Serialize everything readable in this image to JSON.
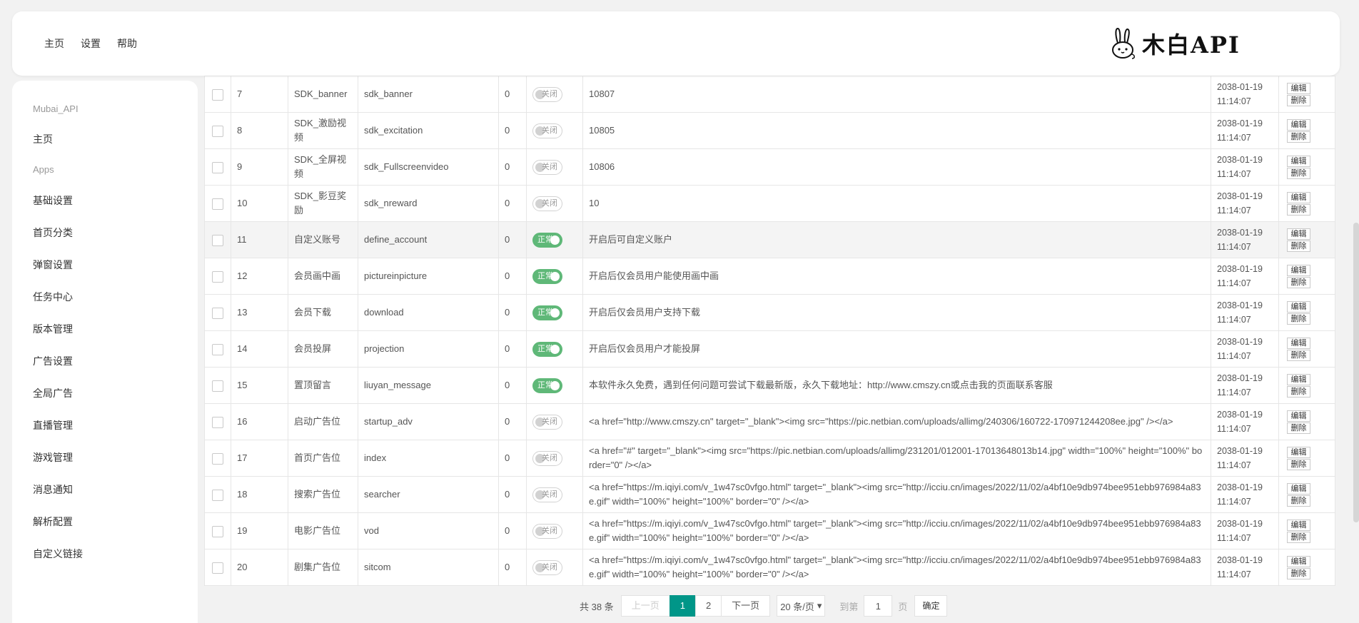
{
  "header": {
    "nav": [
      "主页",
      "设置",
      "帮助"
    ],
    "logo_text": "木白API"
  },
  "sidebar": {
    "brand": "Mubai_API",
    "home": "主页",
    "group": "Apps",
    "items": [
      "基础设置",
      "首页分类",
      "弹窗设置",
      "任务中心",
      "版本管理",
      "广告设置",
      "全局广告",
      "直播管理",
      "游戏管理",
      "消息通知",
      "解析配置",
      "自定义链接"
    ]
  },
  "table": {
    "rows": [
      {
        "id": "7",
        "name": "SDK_banner",
        "key": "sdk_banner",
        "num": "0",
        "status": "关闭",
        "on": false,
        "value": "10807",
        "time1": "2038-01-19",
        "time2": "11:14:07"
      },
      {
        "id": "8",
        "name": "SDK_激励视频",
        "key": "sdk_excitation",
        "num": "0",
        "status": "关闭",
        "on": false,
        "value": "10805",
        "time1": "2038-01-19",
        "time2": "11:14:07"
      },
      {
        "id": "9",
        "name": "SDK_全屏视频",
        "key": "sdk_Fullscreenvideo",
        "num": "0",
        "status": "关闭",
        "on": false,
        "value": "10806",
        "time1": "2038-01-19",
        "time2": "11:14:07"
      },
      {
        "id": "10",
        "name": "SDK_影豆奖励",
        "key": "sdk_nreward",
        "num": "0",
        "status": "关闭",
        "on": false,
        "value": "10",
        "time1": "2038-01-19",
        "time2": "11:14:07"
      },
      {
        "id": "11",
        "name": "自定义账号",
        "key": "define_account",
        "num": "0",
        "status": "正常",
        "on": true,
        "value": "开启后可自定义账户",
        "time1": "2038-01-19",
        "time2": "11:14:07"
      },
      {
        "id": "12",
        "name": "会员画中画",
        "key": "pictureinpicture",
        "num": "0",
        "status": "正常",
        "on": true,
        "value": "开启后仅会员用户能使用画中画",
        "time1": "2038-01-19",
        "time2": "11:14:07"
      },
      {
        "id": "13",
        "name": "会员下载",
        "key": "download",
        "num": "0",
        "status": "正常",
        "on": true,
        "value": "开启后仅会员用户支持下载",
        "time1": "2038-01-19",
        "time2": "11:14:07"
      },
      {
        "id": "14",
        "name": "会员投屏",
        "key": "projection",
        "num": "0",
        "status": "正常",
        "on": true,
        "value": "开启后仅会员用户才能投屏",
        "time1": "2038-01-19",
        "time2": "11:14:07"
      },
      {
        "id": "15",
        "name": "置顶留言",
        "key": "liuyan_message",
        "num": "0",
        "status": "正常",
        "on": true,
        "value": "本软件永久免费，遇到任何问题可尝试下载最新版，永久下载地址：http://www.cmszy.cn或点击我的页面联系客服",
        "time1": "2038-01-19",
        "time2": "11:14:07"
      },
      {
        "id": "16",
        "name": "启动广告位",
        "key": "startup_adv",
        "num": "0",
        "status": "关闭",
        "on": false,
        "value": "<a href=\"http://www.cmszy.cn\" target=\"_blank\"><img src=\"https://pic.netbian.com/uploads/allimg/240306/160722-170971244208ee.jpg\" /></a>",
        "time1": "2038-01-19",
        "time2": "11:14:07"
      },
      {
        "id": "17",
        "name": "首页广告位",
        "key": "index",
        "num": "0",
        "status": "关闭",
        "on": false,
        "value": "<a href=\"#\" target=\"_blank\"><img src=\"https://pic.netbian.com/uploads/allimg/231201/012001-17013648013b14.jpg\" width=\"100%\" height=\"100%\" border=\"0\" /></a>",
        "time1": "2038-01-19",
        "time2": "11:14:07"
      },
      {
        "id": "18",
        "name": "搜索广告位",
        "key": "searcher",
        "num": "0",
        "status": "关闭",
        "on": false,
        "value": "<a href=\"https://m.iqiyi.com/v_1w47sc0vfgo.html\" target=\"_blank\"><img src=\"http://icciu.cn/images/2022/11/02/a4bf10e9db974bee951ebb976984a83e.gif\" width=\"100%\" height=\"100%\" border=\"0\" /></a>",
        "time1": "2038-01-19",
        "time2": "11:14:07"
      },
      {
        "id": "19",
        "name": "电影广告位",
        "key": "vod",
        "num": "0",
        "status": "关闭",
        "on": false,
        "value": "<a href=\"https://m.iqiyi.com/v_1w47sc0vfgo.html\" target=\"_blank\"><img src=\"http://icciu.cn/images/2022/11/02/a4bf10e9db974bee951ebb976984a83e.gif\" width=\"100%\" height=\"100%\" border=\"0\" /></a>",
        "time1": "2038-01-19",
        "time2": "11:14:07"
      },
      {
        "id": "20",
        "name": "剧集广告位",
        "key": "sitcom",
        "num": "0",
        "status": "关闭",
        "on": false,
        "value": "<a href=\"https://m.iqiyi.com/v_1w47sc0vfgo.html\" target=\"_blank\"><img src=\"http://icciu.cn/images/2022/11/02/a4bf10e9db974bee951ebb976984a83e.gif\" width=\"100%\" height=\"100%\" border=\"0\" /></a>",
        "time1": "2038-01-19",
        "time2": "11:14:07"
      }
    ],
    "edit_label": "编辑",
    "delete_label": "删除"
  },
  "pager": {
    "total": "共 38 条",
    "prev": "上一页",
    "pages": [
      "1",
      "2"
    ],
    "current": "1",
    "next": "下一页",
    "limit": "20 条/页",
    "goto_label": "到第",
    "goto_value": "1",
    "page_unit": "页",
    "confirm": "确定"
  },
  "colors": {
    "switch_on": "#5fb878",
    "active_page": "#009688"
  }
}
